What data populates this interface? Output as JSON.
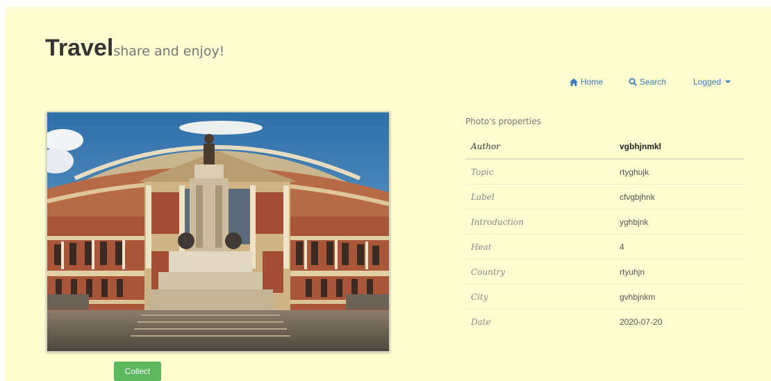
{
  "brand": {
    "title": "Travel",
    "subtitle": "share and enjoy!"
  },
  "nav": {
    "home": "Home",
    "search": "Search",
    "user": "Logged"
  },
  "properties": {
    "caption": "Photo's properties",
    "rows": [
      {
        "key": "Author",
        "value": "vgbhjnmkl"
      },
      {
        "key": "Topic",
        "value": "rtyghujk"
      },
      {
        "key": "Label",
        "value": "cfvgbjhnk"
      },
      {
        "key": "Introduction",
        "value": "yghbjnk"
      },
      {
        "key": "Heat",
        "value": "4"
      },
      {
        "key": "Country",
        "value": "rtyuhjn"
      },
      {
        "key": "City",
        "value": "gvhbjnkm"
      },
      {
        "key": "Date",
        "value": "2020-07-20"
      }
    ]
  },
  "actions": {
    "collect": "Collect"
  },
  "colors": {
    "background": "#fefed3",
    "link": "#3a7ab8",
    "collect_button": "#5cb85c"
  },
  "icons": {
    "home": "home-icon",
    "search": "search-icon",
    "dropdown": "caret-down-icon"
  }
}
